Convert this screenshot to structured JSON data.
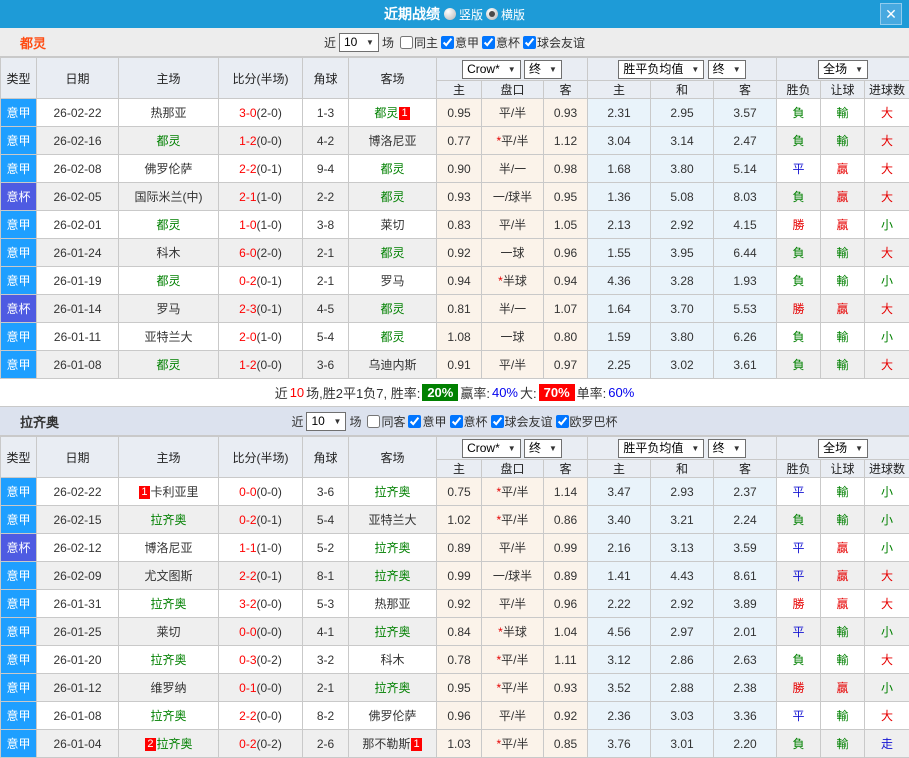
{
  "titlebar": {
    "title": "近期战绩",
    "radio_vertical": "竖版",
    "radio_horizontal": "横版",
    "selected_layout": "横版",
    "close_icon": "✕"
  },
  "filter_labels": {
    "near": "近",
    "games": "场"
  },
  "table_header": {
    "type": "类型",
    "date": "日期",
    "home": "主场",
    "score": "比分(半场)",
    "corner": "角球",
    "away": "客场",
    "sub_home": "主",
    "sub_handicap": "盘口",
    "sub_away": "客",
    "sub_avg_home": "主",
    "sub_avg_draw": "和",
    "sub_avg_away": "客",
    "sub_result": "胜负",
    "sub_letball": "让球",
    "sub_goals": "进球数",
    "dd_bookmaker": "Crow*",
    "dd_final": "终",
    "dd_avg": "胜平负均值",
    "dd_fulltime": "全场",
    "dd_arrow": "▼"
  },
  "colors": {
    "titlebar": "#1E9BD7",
    "serie_a_badge": "#1E9FFF",
    "coppa_badge": "#4E5BE2",
    "focal_team": "#008000",
    "win": "#E60000",
    "loss": "#008000",
    "draw": "#1414D2",
    "rank_badge": "#FF0000",
    "score": "#FF0000",
    "team1_title": "#FF4B12",
    "win_rate_bg": "#008000",
    "big_rate_bg": "#FF0000",
    "pct_blue": "#0000EE",
    "crow_col_bg": "#FBF3EA",
    "avg_col_bg": "#E9F3FA"
  },
  "sections": [
    {
      "team": "都灵",
      "filter": {
        "count": "10",
        "checkboxes": [
          {
            "label": "同主",
            "checked": false
          },
          {
            "label": "意甲",
            "checked": true
          },
          {
            "label": "意杯",
            "checked": true
          },
          {
            "label": "球会友谊",
            "checked": true
          }
        ]
      },
      "rows": [
        {
          "league": "意甲",
          "league_class": "jia",
          "date": "26-02-22",
          "home_badge": "",
          "home": "热那亚",
          "home_class": "",
          "score": "3-0",
          "half": "(2-0)",
          "corner": "1-3",
          "away": "都灵",
          "away_class": "focal",
          "away_badge": "1",
          "odds_home": "0.95",
          "star": "",
          "handicap": "平/半",
          "odds_away": "0.93",
          "avg_home": "2.31",
          "avg_draw": "2.95",
          "avg_away": "3.57",
          "result": "負",
          "result_class": "green",
          "letball": "輸",
          "letball_class": "green",
          "goals": "大",
          "goals_class": "red"
        },
        {
          "league": "意甲",
          "league_class": "jia",
          "date": "26-02-16",
          "home_badge": "",
          "home": "都灵",
          "home_class": "focal",
          "score": "1-2",
          "half": "(0-0)",
          "corner": "4-2",
          "away": "博洛尼亚",
          "away_class": "",
          "away_badge": "",
          "odds_home": "0.77",
          "star": "*",
          "handicap": "平/半",
          "odds_away": "1.12",
          "avg_home": "3.04",
          "avg_draw": "3.14",
          "avg_away": "2.47",
          "result": "負",
          "result_class": "green",
          "letball": "輸",
          "letball_class": "green",
          "goals": "大",
          "goals_class": "red"
        },
        {
          "league": "意甲",
          "league_class": "jia",
          "date": "26-02-08",
          "home_badge": "",
          "home": "佛罗伦萨",
          "home_class": "",
          "score": "2-2",
          "half": "(0-1)",
          "corner": "9-4",
          "away": "都灵",
          "away_class": "focal",
          "away_badge": "",
          "odds_home": "0.90",
          "star": "",
          "handicap": "半/一",
          "odds_away": "0.98",
          "avg_home": "1.68",
          "avg_draw": "3.80",
          "avg_away": "5.14",
          "result": "平",
          "result_class": "blue",
          "letball": "贏",
          "letball_class": "red",
          "goals": "大",
          "goals_class": "red"
        },
        {
          "league": "意杯",
          "league_class": "bei",
          "date": "26-02-05",
          "home_badge": "",
          "home": "国际米兰(中)",
          "home_class": "",
          "score": "2-1",
          "half": "(1-0)",
          "corner": "2-2",
          "away": "都灵",
          "away_class": "focal",
          "away_badge": "",
          "odds_home": "0.93",
          "star": "",
          "handicap": "一/球半",
          "odds_away": "0.95",
          "avg_home": "1.36",
          "avg_draw": "5.08",
          "avg_away": "8.03",
          "result": "負",
          "result_class": "green",
          "letball": "贏",
          "letball_class": "red",
          "goals": "大",
          "goals_class": "red"
        },
        {
          "league": "意甲",
          "league_class": "jia",
          "date": "26-02-01",
          "home_badge": "",
          "home": "都灵",
          "home_class": "focal",
          "score": "1-0",
          "half": "(1-0)",
          "corner": "3-8",
          "away": "莱切",
          "away_class": "",
          "away_badge": "",
          "odds_home": "0.83",
          "star": "",
          "handicap": "平/半",
          "odds_away": "1.05",
          "avg_home": "2.13",
          "avg_draw": "2.92",
          "avg_away": "4.15",
          "result": "勝",
          "result_class": "red",
          "letball": "贏",
          "letball_class": "red",
          "goals": "小",
          "goals_class": "green"
        },
        {
          "league": "意甲",
          "league_class": "jia",
          "date": "26-01-24",
          "home_badge": "",
          "home": "科木",
          "home_class": "",
          "score": "6-0",
          "half": "(2-0)",
          "corner": "2-1",
          "away": "都灵",
          "away_class": "focal",
          "away_badge": "",
          "odds_home": "0.92",
          "star": "",
          "handicap": "一球",
          "odds_away": "0.96",
          "avg_home": "1.55",
          "avg_draw": "3.95",
          "avg_away": "6.44",
          "result": "負",
          "result_class": "green",
          "letball": "輸",
          "letball_class": "green",
          "goals": "大",
          "goals_class": "red"
        },
        {
          "league": "意甲",
          "league_class": "jia",
          "date": "26-01-19",
          "home_badge": "",
          "home": "都灵",
          "home_class": "focal",
          "score": "0-2",
          "half": "(0-1)",
          "corner": "2-1",
          "away": "罗马",
          "away_class": "",
          "away_badge": "",
          "odds_home": "0.94",
          "star": "*",
          "handicap": "半球",
          "odds_away": "0.94",
          "avg_home": "4.36",
          "avg_draw": "3.28",
          "avg_away": "1.93",
          "result": "負",
          "result_class": "green",
          "letball": "輸",
          "letball_class": "green",
          "goals": "小",
          "goals_class": "green"
        },
        {
          "league": "意杯",
          "league_class": "bei",
          "date": "26-01-14",
          "home_badge": "",
          "home": "罗马",
          "home_class": "",
          "score": "2-3",
          "half": "(0-1)",
          "corner": "4-5",
          "away": "都灵",
          "away_class": "focal",
          "away_badge": "",
          "odds_home": "0.81",
          "star": "",
          "handicap": "半/一",
          "odds_away": "1.07",
          "avg_home": "1.64",
          "avg_draw": "3.70",
          "avg_away": "5.53",
          "result": "勝",
          "result_class": "red",
          "letball": "贏",
          "letball_class": "red",
          "goals": "大",
          "goals_class": "red"
        },
        {
          "league": "意甲",
          "league_class": "jia",
          "date": "26-01-11",
          "home_badge": "",
          "home": "亚特兰大",
          "home_class": "",
          "score": "2-0",
          "half": "(1-0)",
          "corner": "5-4",
          "away": "都灵",
          "away_class": "focal",
          "away_badge": "",
          "odds_home": "1.08",
          "star": "",
          "handicap": "一球",
          "odds_away": "0.80",
          "avg_home": "1.59",
          "avg_draw": "3.80",
          "avg_away": "6.26",
          "result": "負",
          "result_class": "green",
          "letball": "輸",
          "letball_class": "green",
          "goals": "小",
          "goals_class": "green"
        },
        {
          "league": "意甲",
          "league_class": "jia",
          "date": "26-01-08",
          "home_badge": "",
          "home": "都灵",
          "home_class": "focal",
          "score": "1-2",
          "half": "(0-0)",
          "corner": "3-6",
          "away": "乌迪内斯",
          "away_class": "",
          "away_badge": "",
          "odds_home": "0.91",
          "star": "",
          "handicap": "平/半",
          "odds_away": "0.97",
          "avg_home": "2.25",
          "avg_draw": "3.02",
          "avg_away": "3.61",
          "result": "負",
          "result_class": "green",
          "letball": "輸",
          "letball_class": "green",
          "goals": "大",
          "goals_class": "red"
        }
      ],
      "summary": {
        "near_label": "近",
        "count": "10",
        "record": "场,胜2平1负7, 胜率:",
        "win_rate": "20%",
        "win_label": "赢率:",
        "win_pct": "40%",
        "big_label": "大:",
        "big_rate": "70%",
        "single_label": "单率:",
        "single_pct": "60%"
      }
    },
    {
      "team": "拉齐奥",
      "filter": {
        "count": "10",
        "checkboxes": [
          {
            "label": "同客",
            "checked": false
          },
          {
            "label": "意甲",
            "checked": true
          },
          {
            "label": "意杯",
            "checked": true
          },
          {
            "label": "球会友谊",
            "checked": true
          },
          {
            "label": "欧罗巴杯",
            "checked": true
          }
        ]
      },
      "rows": [
        {
          "league": "意甲",
          "league_class": "jia",
          "date": "26-02-22",
          "home_badge": "1",
          "home": "卡利亚里",
          "home_class": "",
          "score": "0-0",
          "half": "(0-0)",
          "corner": "3-6",
          "away": "拉齐奥",
          "away_class": "focal",
          "away_badge": "",
          "odds_home": "0.75",
          "star": "*",
          "handicap": "平/半",
          "odds_away": "1.14",
          "avg_home": "3.47",
          "avg_draw": "2.93",
          "avg_away": "2.37",
          "result": "平",
          "result_class": "blue",
          "letball": "輸",
          "letball_class": "green",
          "goals": "小",
          "goals_class": "green"
        },
        {
          "league": "意甲",
          "league_class": "jia",
          "date": "26-02-15",
          "home_badge": "",
          "home": "拉齐奥",
          "home_class": "focal",
          "score": "0-2",
          "half": "(0-1)",
          "corner": "5-4",
          "away": "亚特兰大",
          "away_class": "",
          "away_badge": "",
          "odds_home": "1.02",
          "star": "*",
          "handicap": "平/半",
          "odds_away": "0.86",
          "avg_home": "3.40",
          "avg_draw": "3.21",
          "avg_away": "2.24",
          "result": "負",
          "result_class": "green",
          "letball": "輸",
          "letball_class": "green",
          "goals": "小",
          "goals_class": "green"
        },
        {
          "league": "意杯",
          "league_class": "bei",
          "date": "26-02-12",
          "home_badge": "",
          "home": "博洛尼亚",
          "home_class": "",
          "score": "1-1",
          "half": "(1-0)",
          "corner": "5-2",
          "away": "拉齐奥",
          "away_class": "focal",
          "away_badge": "",
          "odds_home": "0.89",
          "star": "",
          "handicap": "平/半",
          "odds_away": "0.99",
          "avg_home": "2.16",
          "avg_draw": "3.13",
          "avg_away": "3.59",
          "result": "平",
          "result_class": "blue",
          "letball": "贏",
          "letball_class": "red",
          "goals": "小",
          "goals_class": "green"
        },
        {
          "league": "意甲",
          "league_class": "jia",
          "date": "26-02-09",
          "home_badge": "",
          "home": "尤文图斯",
          "home_class": "",
          "score": "2-2",
          "half": "(0-1)",
          "corner": "8-1",
          "away": "拉齐奥",
          "away_class": "focal",
          "away_badge": "",
          "odds_home": "0.99",
          "star": "",
          "handicap": "一/球半",
          "odds_away": "0.89",
          "avg_home": "1.41",
          "avg_draw": "4.43",
          "avg_away": "8.61",
          "result": "平",
          "result_class": "blue",
          "letball": "贏",
          "letball_class": "red",
          "goals": "大",
          "goals_class": "red"
        },
        {
          "league": "意甲",
          "league_class": "jia",
          "date": "26-01-31",
          "home_badge": "",
          "home": "拉齐奥",
          "home_class": "focal",
          "score": "3-2",
          "half": "(0-0)",
          "corner": "5-3",
          "away": "热那亚",
          "away_class": "",
          "away_badge": "",
          "odds_home": "0.92",
          "star": "",
          "handicap": "平/半",
          "odds_away": "0.96",
          "avg_home": "2.22",
          "avg_draw": "2.92",
          "avg_away": "3.89",
          "result": "勝",
          "result_class": "red",
          "letball": "贏",
          "letball_class": "red",
          "goals": "大",
          "goals_class": "red"
        },
        {
          "league": "意甲",
          "league_class": "jia",
          "date": "26-01-25",
          "home_badge": "",
          "home": "莱切",
          "home_class": "",
          "score": "0-0",
          "half": "(0-0)",
          "corner": "4-1",
          "away": "拉齐奥",
          "away_class": "focal",
          "away_badge": "",
          "odds_home": "0.84",
          "star": "*",
          "handicap": "半球",
          "odds_away": "1.04",
          "avg_home": "4.56",
          "avg_draw": "2.97",
          "avg_away": "2.01",
          "result": "平",
          "result_class": "blue",
          "letball": "輸",
          "letball_class": "green",
          "goals": "小",
          "goals_class": "green"
        },
        {
          "league": "意甲",
          "league_class": "jia",
          "date": "26-01-20",
          "home_badge": "",
          "home": "拉齐奥",
          "home_class": "focal",
          "score": "0-3",
          "half": "(0-2)",
          "corner": "3-2",
          "away": "科木",
          "away_class": "",
          "away_badge": "",
          "odds_home": "0.78",
          "star": "*",
          "handicap": "平/半",
          "odds_away": "1.11",
          "avg_home": "3.12",
          "avg_draw": "2.86",
          "avg_away": "2.63",
          "result": "負",
          "result_class": "green",
          "letball": "輸",
          "letball_class": "green",
          "goals": "大",
          "goals_class": "red"
        },
        {
          "league": "意甲",
          "league_class": "jia",
          "date": "26-01-12",
          "home_badge": "",
          "home": "维罗纳",
          "home_class": "",
          "score": "0-1",
          "half": "(0-0)",
          "corner": "2-1",
          "away": "拉齐奥",
          "away_class": "focal",
          "away_badge": "",
          "odds_home": "0.95",
          "star": "*",
          "handicap": "平/半",
          "odds_away": "0.93",
          "avg_home": "3.52",
          "avg_draw": "2.88",
          "avg_away": "2.38",
          "result": "勝",
          "result_class": "red",
          "letball": "贏",
          "letball_class": "red",
          "goals": "小",
          "goals_class": "green"
        },
        {
          "league": "意甲",
          "league_class": "jia",
          "date": "26-01-08",
          "home_badge": "",
          "home": "拉齐奥",
          "home_class": "focal",
          "score": "2-2",
          "half": "(0-0)",
          "corner": "8-2",
          "away": "佛罗伦萨",
          "away_class": "",
          "away_badge": "",
          "odds_home": "0.96",
          "star": "",
          "handicap": "平/半",
          "odds_away": "0.92",
          "avg_home": "2.36",
          "avg_draw": "3.03",
          "avg_away": "3.36",
          "result": "平",
          "result_class": "blue",
          "letball": "輸",
          "letball_class": "green",
          "goals": "大",
          "goals_class": "red"
        },
        {
          "league": "意甲",
          "league_class": "jia",
          "date": "26-01-04",
          "home_badge": "2",
          "home": "拉齐奥",
          "home_class": "focal",
          "score": "0-2",
          "half": "(0-2)",
          "corner": "2-6",
          "away": "那不勒斯",
          "away_class": "",
          "away_badge": "1",
          "odds_home": "1.03",
          "star": "*",
          "handicap": "平/半",
          "odds_away": "0.85",
          "avg_home": "3.76",
          "avg_draw": "3.01",
          "avg_away": "2.20",
          "result": "負",
          "result_class": "green",
          "letball": "輸",
          "letball_class": "green",
          "goals": "走",
          "goals_class": "blue"
        }
      ]
    }
  ]
}
